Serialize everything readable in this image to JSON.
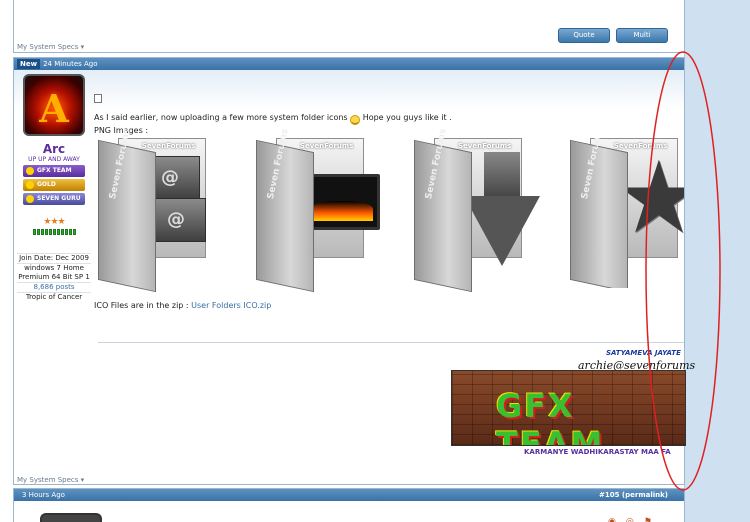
{
  "prev_post": {
    "specs_label": "My System Specs",
    "quote_label": "Quote",
    "multi_label": "Multi"
  },
  "post": {
    "new_badge": "New",
    "time": "24 Minutes Ago",
    "user": {
      "name": "Arc",
      "title": "UP UP AND AWAY",
      "ranks": [
        "GFX TEAM",
        "GOLD MEMBER",
        "SEVEN GURU"
      ],
      "join_date": "Join Date: Dec 2009",
      "os": "windows 7 Home Premium 64 Bit SP 1",
      "posts": "8,686 posts",
      "location": "Tropic of Cancer"
    },
    "message_line1_a": "As I said earlier, now uploading a few more system folder icons",
    "message_line1_b": "Hope you guys like it .",
    "message_line2": "PNG Images :",
    "folder_brand": "SevenForums",
    "folder_vertical": "Seven Forums",
    "zip_text": "ICO Files are in the zip :",
    "zip_link": "User Folders ICO.zip",
    "signature": {
      "top": "SATYAMEVA JAYATE",
      "email": "archie@sevenforums",
      "banner": "GFX TEAM",
      "bottom": "KARMANYE WADHIKARASTAY MAA FA"
    },
    "specs_label": "My System Specs"
  },
  "next_post": {
    "time": "3 Hours Ago",
    "permalink": "#105 (permalink)"
  },
  "colors": {
    "header_blue": "#3a72a6",
    "right_pane": "#cfe1f1",
    "annotation_red": "#e02020"
  }
}
